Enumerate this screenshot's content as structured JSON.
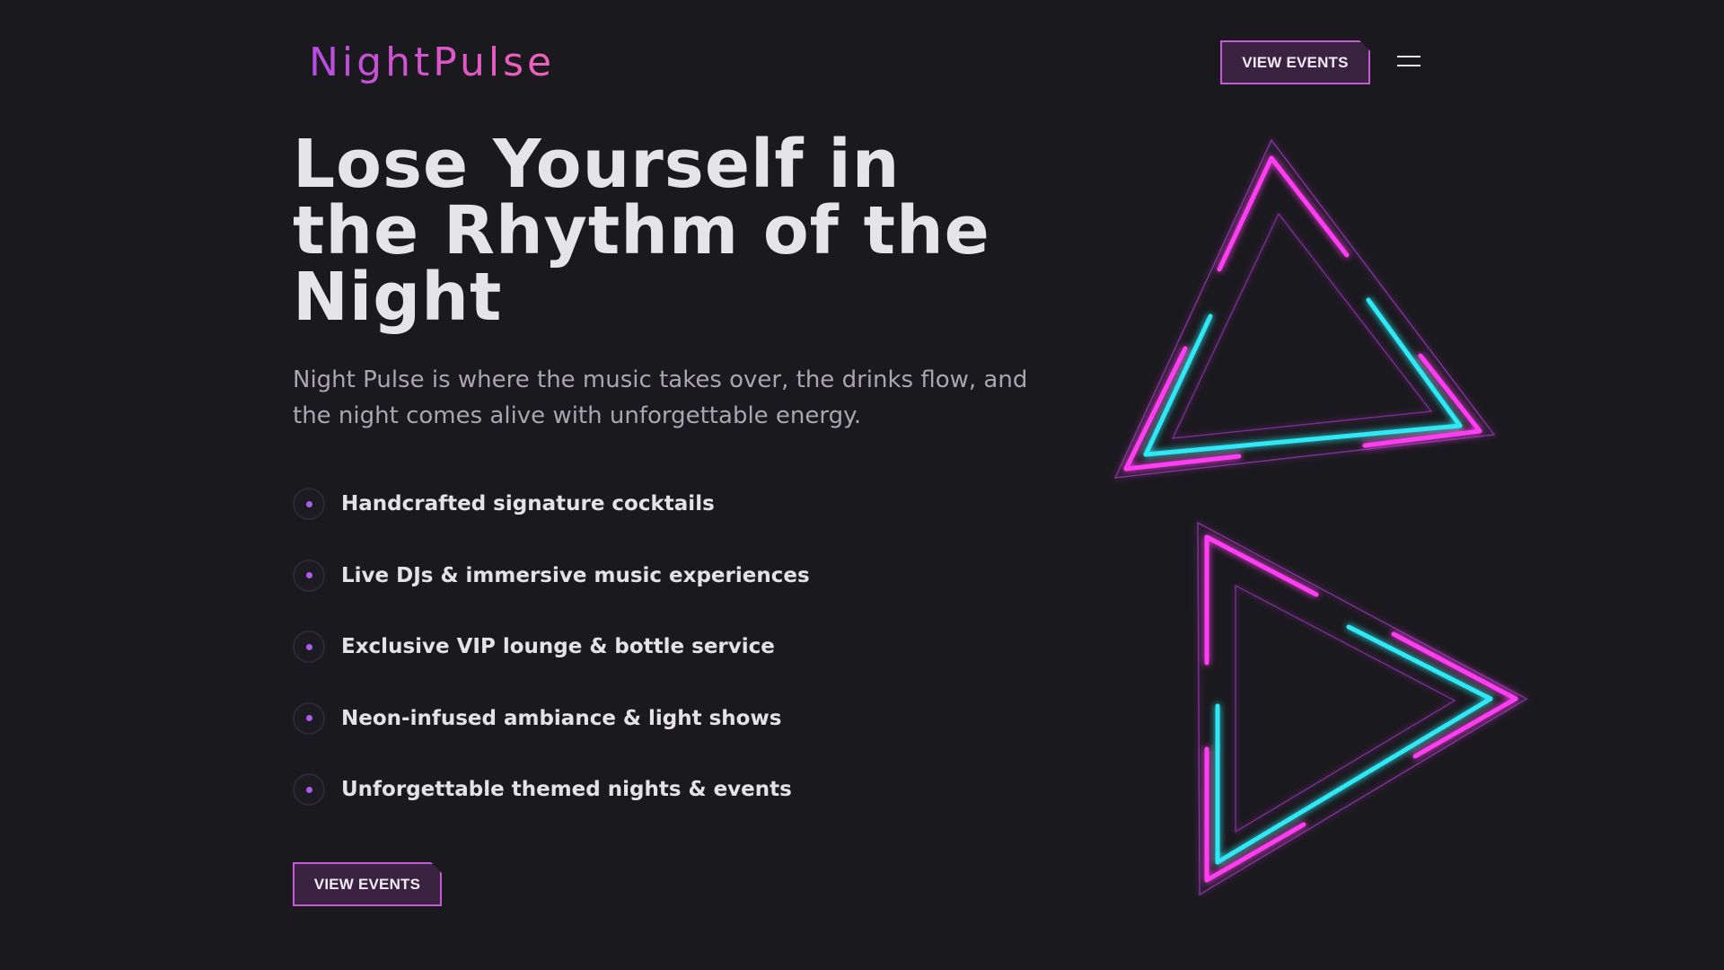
{
  "brand": {
    "logo_text": "NightPulse"
  },
  "header": {
    "cta_label": "VIEW EVENTS",
    "menu_icon": "hamburger-menu-icon"
  },
  "hero": {
    "title": "Lose Yourself in the Rhythm of the Night",
    "subtitle": "Night Pulse is where the music takes over, the drinks flow, and the night comes alive with unforgettable energy.",
    "features": [
      {
        "label": "Handcrafted signature cocktails"
      },
      {
        "label": "Live DJs & immersive music experiences"
      },
      {
        "label": "Exclusive VIP lounge & bottle service"
      },
      {
        "label": "Neon-infused ambiance & light shows"
      },
      {
        "label": "Unforgettable themed nights & events"
      }
    ],
    "cta_label": "VIEW EVENTS"
  },
  "decoration": {
    "icons": [
      "neon-triangle-up-icon",
      "neon-triangle-play-icon"
    ]
  },
  "colors": {
    "background": "#1a191d",
    "accent_purple": "#c55ad9",
    "neon_pink": "#ff3df2",
    "neon_cyan": "#2ee9f5",
    "text_primary": "#e5e4e8",
    "text_secondary": "#a9a6ad"
  }
}
